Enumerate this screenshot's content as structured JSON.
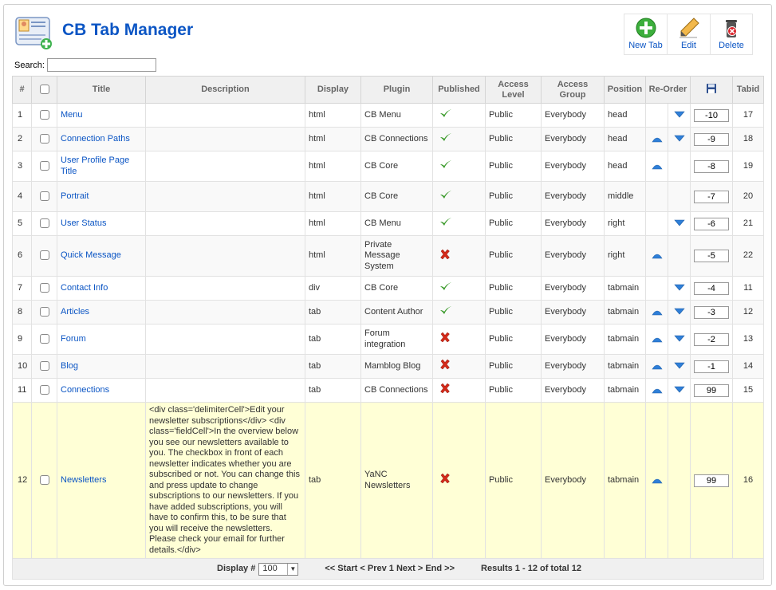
{
  "page": {
    "title": "CB Tab Manager"
  },
  "toolbar": {
    "new_label": "New Tab",
    "edit_label": "Edit",
    "delete_label": "Delete"
  },
  "search": {
    "label": "Search:",
    "value": ""
  },
  "columns": [
    "#",
    "",
    "Title",
    "Description",
    "Display",
    "Plugin",
    "Published",
    "Access Level",
    "Access Group",
    "Position",
    "Re-Order",
    "",
    "Tabid"
  ],
  "rows": [
    {
      "num": "1",
      "title": "Menu",
      "description": "",
      "display": "html",
      "plugin": "CB Menu",
      "plugin_enabled": true,
      "published": true,
      "access": "Public",
      "group": "Everybody",
      "position": "head",
      "up": false,
      "down": true,
      "order": "-10",
      "tabid": "17"
    },
    {
      "num": "2",
      "title": "Connection Paths",
      "description": "",
      "display": "html",
      "plugin": "CB Connections",
      "plugin_enabled": true,
      "published": true,
      "access": "Public",
      "group": "Everybody",
      "position": "head",
      "up": true,
      "down": true,
      "order": "-9",
      "tabid": "18"
    },
    {
      "num": "3",
      "title": "User Profile Page Title",
      "description": "",
      "display": "html",
      "plugin": "CB Core",
      "plugin_enabled": true,
      "published": true,
      "access": "Public",
      "group": "Everybody",
      "position": "head",
      "up": true,
      "down": false,
      "order": "-8",
      "tabid": "19"
    },
    {
      "num": "4",
      "title": "Portrait",
      "description": "",
      "display": "html",
      "plugin": "CB Core",
      "plugin_enabled": true,
      "published": true,
      "access": "Public",
      "group": "Everybody",
      "position": "middle",
      "up": false,
      "down": false,
      "order": "-7",
      "tabid": "20"
    },
    {
      "num": "5",
      "title": "User Status",
      "description": "",
      "display": "html",
      "plugin": "CB Menu",
      "plugin_enabled": true,
      "published": true,
      "access": "Public",
      "group": "Everybody",
      "position": "right",
      "up": false,
      "down": true,
      "order": "-6",
      "tabid": "21"
    },
    {
      "num": "6",
      "title": "Quick Message",
      "description": "",
      "display": "html",
      "plugin": "Private Message System",
      "plugin_enabled": false,
      "published": false,
      "access": "Public",
      "group": "Everybody",
      "position": "right",
      "up": true,
      "down": false,
      "order": "-5",
      "tabid": "22"
    },
    {
      "num": "7",
      "title": "Contact Info",
      "description": "",
      "display": "div",
      "plugin": "CB Core",
      "plugin_enabled": true,
      "published": true,
      "access": "Public",
      "group": "Everybody",
      "position": "tabmain",
      "up": false,
      "down": true,
      "order": "-4",
      "tabid": "11"
    },
    {
      "num": "8",
      "title": "Articles",
      "description": "",
      "display": "tab",
      "plugin": "Content Author",
      "plugin_enabled": true,
      "published": true,
      "access": "Public",
      "group": "Everybody",
      "position": "tabmain",
      "up": true,
      "down": true,
      "order": "-3",
      "tabid": "12"
    },
    {
      "num": "9",
      "title": "Forum",
      "description": "",
      "display": "tab",
      "plugin": "Forum integration",
      "plugin_enabled": false,
      "published": false,
      "access": "Public",
      "group": "Everybody",
      "position": "tabmain",
      "up": true,
      "down": true,
      "order": "-2",
      "tabid": "13"
    },
    {
      "num": "10",
      "title": "Blog",
      "description": "",
      "display": "tab",
      "plugin": "Mamblog Blog",
      "plugin_enabled": false,
      "published": false,
      "access": "Public",
      "group": "Everybody",
      "position": "tabmain",
      "up": true,
      "down": true,
      "order": "-1",
      "tabid": "14"
    },
    {
      "num": "11",
      "title": "Connections",
      "description": "",
      "display": "tab",
      "plugin": "CB Connections",
      "plugin_enabled": true,
      "published": false,
      "access": "Public",
      "group": "Everybody",
      "position": "tabmain",
      "up": true,
      "down": true,
      "order": "99",
      "tabid": "15"
    },
    {
      "num": "12",
      "title": "Newsletters",
      "description": "<div class='delimiterCell'>Edit your newsletter subscriptions</div> <div class='fieldCell'>In the overview below you see our newsletters available to you. The checkbox in front of each newsletter indicates whether you are subscribed or not. You can change this and press update to change subscriptions to our newsletters. If you have added subscriptions, you will have to confirm this, to be sure that you will receive the newsletters. Please check your email for further details.</div>",
      "display": "tab",
      "plugin": "YaNC Newsletters",
      "plugin_enabled": false,
      "published": false,
      "access": "Public",
      "group": "Everybody",
      "position": "tabmain",
      "up": true,
      "down": false,
      "order": "99",
      "tabid": "16",
      "highlight": true
    }
  ],
  "footer": {
    "display_label": "Display #",
    "display_value": "100",
    "pager": "<< Start < Prev 1 Next > End >>",
    "results": "Results 1 - 12 of total 12"
  },
  "colors": {
    "link": "#0b55c4",
    "disabled_plugin": "#cc0000",
    "access": "#008000",
    "highlight_row": "#ffffd6"
  }
}
